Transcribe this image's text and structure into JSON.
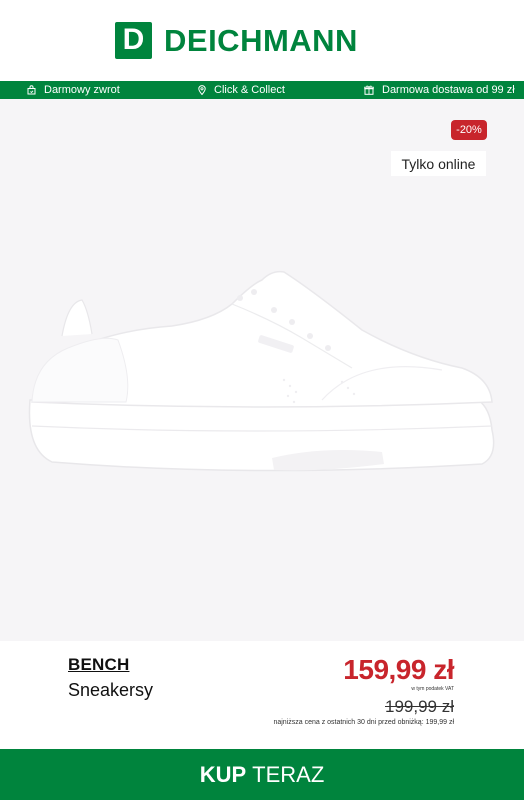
{
  "header": {
    "logo_letter": "D",
    "logo_text": "DEICHMANN"
  },
  "usp_bar": {
    "items": [
      {
        "label": "Darmowy zwrot",
        "icon": "gift-bag-icon"
      },
      {
        "label": "Click & Collect",
        "icon": "location-pin-icon"
      },
      {
        "label": "Darmowa dostawa od 99 zł",
        "icon": "gift-box-icon"
      }
    ]
  },
  "product": {
    "discount": "-20%",
    "online_badge": "Tylko online",
    "image_icon": "white-sneaker-image",
    "brand": "BENCH",
    "name": "Sneakersy",
    "price": "159,99 zł",
    "vat_note": "w tym podatek VAT",
    "old_price": "199,99 zł",
    "lowest_price_note": "najniższa cena z ostatnich 30 dni przed obniżką: 199,99 zł"
  },
  "cta": {
    "bold": "KUP",
    "rest": "TERAZ"
  },
  "colors": {
    "brand_green": "#00843d",
    "sale_red": "#c8252c",
    "product_bg": "#f6f5f7"
  }
}
